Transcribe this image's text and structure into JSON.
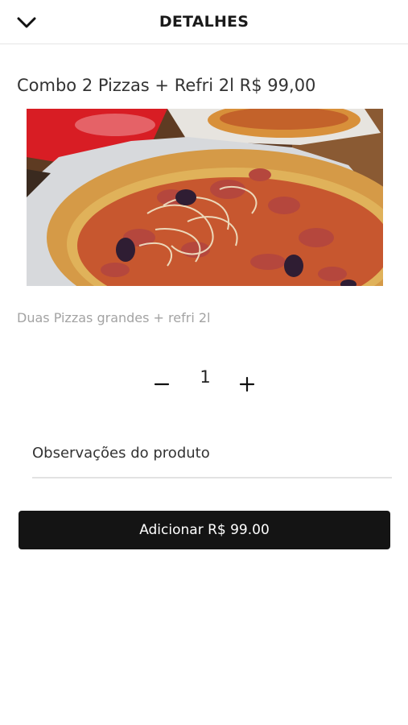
{
  "header": {
    "title": "DETALHES",
    "back_icon": "chevron-down-icon"
  },
  "product": {
    "name_price": "Combo 2 Pizzas + Refri 2l R$ 99,00",
    "description": "Duas Pizzas grandes + refri 2l",
    "image": "pizza-photo"
  },
  "quantity": {
    "value": "1",
    "minus_icon": "minus-icon",
    "plus_icon": "plus-icon"
  },
  "notes": {
    "placeholder": "Observações do produto",
    "value": ""
  },
  "actions": {
    "add_label": "Adicionar R$ 99.00"
  },
  "colors": {
    "button_bg": "#141414",
    "button_text": "#ffffff",
    "description_text": "#a3a3a3"
  }
}
